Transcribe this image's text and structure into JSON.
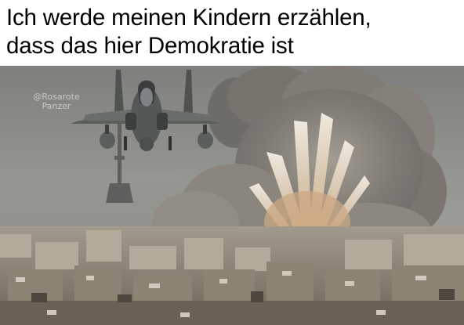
{
  "caption": {
    "line1": "Ich werde meinen Kindern erzählen,",
    "line2": "dass das hier Demokratie ist"
  },
  "watermark": {
    "line1": "@Rosarote",
    "line2": "Panzer"
  },
  "colors": {
    "caption_text": "#000000",
    "caption_background": "#ffffff",
    "sky": "#8e8f8c",
    "smoke": "#7d7a74",
    "fire": "#ff8a1e"
  }
}
